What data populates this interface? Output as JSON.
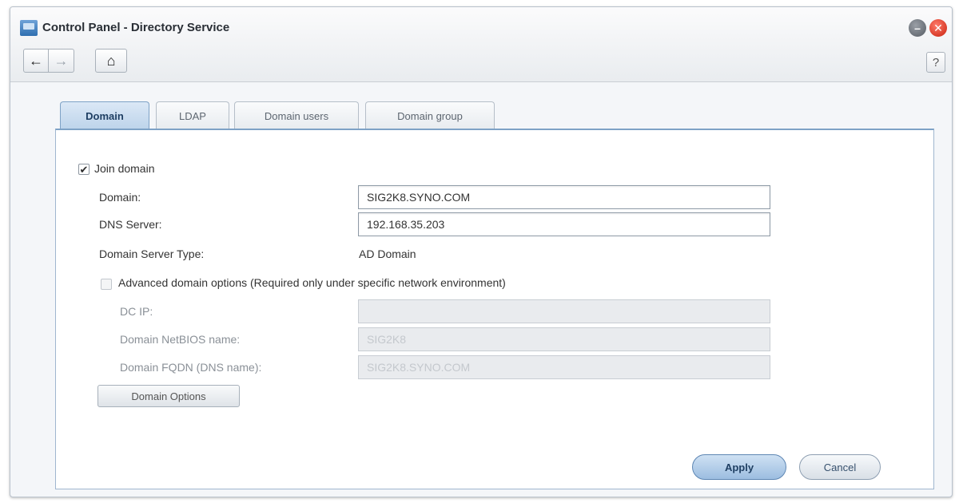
{
  "window": {
    "title": "Control Panel - Directory Service",
    "icons": {
      "app": "control-panel-icon",
      "minimize": "minimize-icon",
      "close": "close-icon",
      "back": "back-arrow-icon",
      "forward": "forward-arrow-icon",
      "home": "home-icon",
      "help": "help-icon"
    },
    "help_label": "?"
  },
  "tabs": [
    {
      "label": "Domain",
      "active": true
    },
    {
      "label": "LDAP",
      "active": false
    },
    {
      "label": "Domain users",
      "active": false
    },
    {
      "label": "Domain group",
      "active": false
    }
  ],
  "form": {
    "join_domain": {
      "label": "Join domain",
      "checked": true
    },
    "domain": {
      "label": "Domain:",
      "value": "SIG2K8.SYNO.COM"
    },
    "dns_server": {
      "label": "DNS Server:",
      "value": "192.168.35.203"
    },
    "server_type": {
      "label": "Domain Server Type:",
      "value": "AD Domain"
    },
    "advanced": {
      "label": "Advanced domain options (Required only under specific network environment)",
      "checked": false
    },
    "dc_ip": {
      "label": "DC IP:",
      "value": ""
    },
    "netbios": {
      "label": "Domain NetBIOS name:",
      "value": "SIG2K8"
    },
    "fqdn": {
      "label": "Domain FQDN (DNS name):",
      "value": "SIG2K8.SYNO.COM"
    },
    "domain_options_button": "Domain Options"
  },
  "footer": {
    "apply": "Apply",
    "cancel": "Cancel"
  },
  "colors": {
    "accent": "#7ea2c6",
    "close": "#c8210d"
  }
}
